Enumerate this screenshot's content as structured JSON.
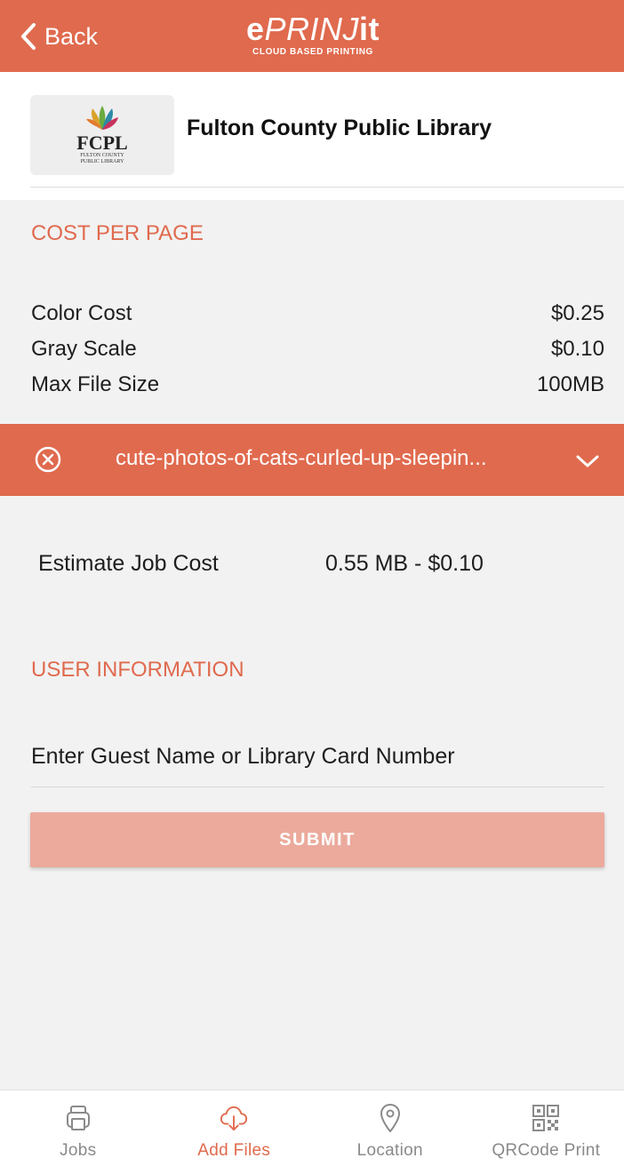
{
  "colors": {
    "accent": "#e06a4e",
    "submit_disabled": "#ebaa9c",
    "background": "#f2f2f2"
  },
  "header": {
    "back_label": "Back",
    "brand_prefix": "e",
    "brand_middle": "PRINJ",
    "brand_suffix": "it",
    "brand_tagline": "CLOUD BASED PRINTING"
  },
  "library": {
    "logo_abbr": "FCPL",
    "logo_line1": "FULTON COUNTY",
    "logo_line2": "PUBLIC LIBRARY",
    "name": "Fulton County Public Library"
  },
  "cost": {
    "title": "COST PER PAGE",
    "rows": [
      {
        "label": "Color Cost",
        "value": "$0.25"
      },
      {
        "label": "Gray Scale",
        "value": "$0.10"
      },
      {
        "label": "Max File Size",
        "value": "100MB"
      }
    ]
  },
  "file": {
    "name": "cute-photos-of-cats-curled-up-sleepin...",
    "remove_icon": "close-circle-icon",
    "expand_icon": "chevron-down-icon"
  },
  "estimate": {
    "label": "Estimate Job Cost",
    "value": "0.55 MB - $0.10"
  },
  "user_info": {
    "title": "USER INFORMATION",
    "placeholder": "Enter Guest Name or Library Card Number",
    "value": ""
  },
  "submit_label": "SUBMIT",
  "tabs": [
    {
      "label": "Jobs",
      "icon": "printer-icon",
      "active": false
    },
    {
      "label": "Add Files",
      "icon": "cloud-download-icon",
      "active": true
    },
    {
      "label": "Location",
      "icon": "location-pin-icon",
      "active": false
    },
    {
      "label": "QRCode Print",
      "icon": "qr-code-icon",
      "active": false
    }
  ]
}
